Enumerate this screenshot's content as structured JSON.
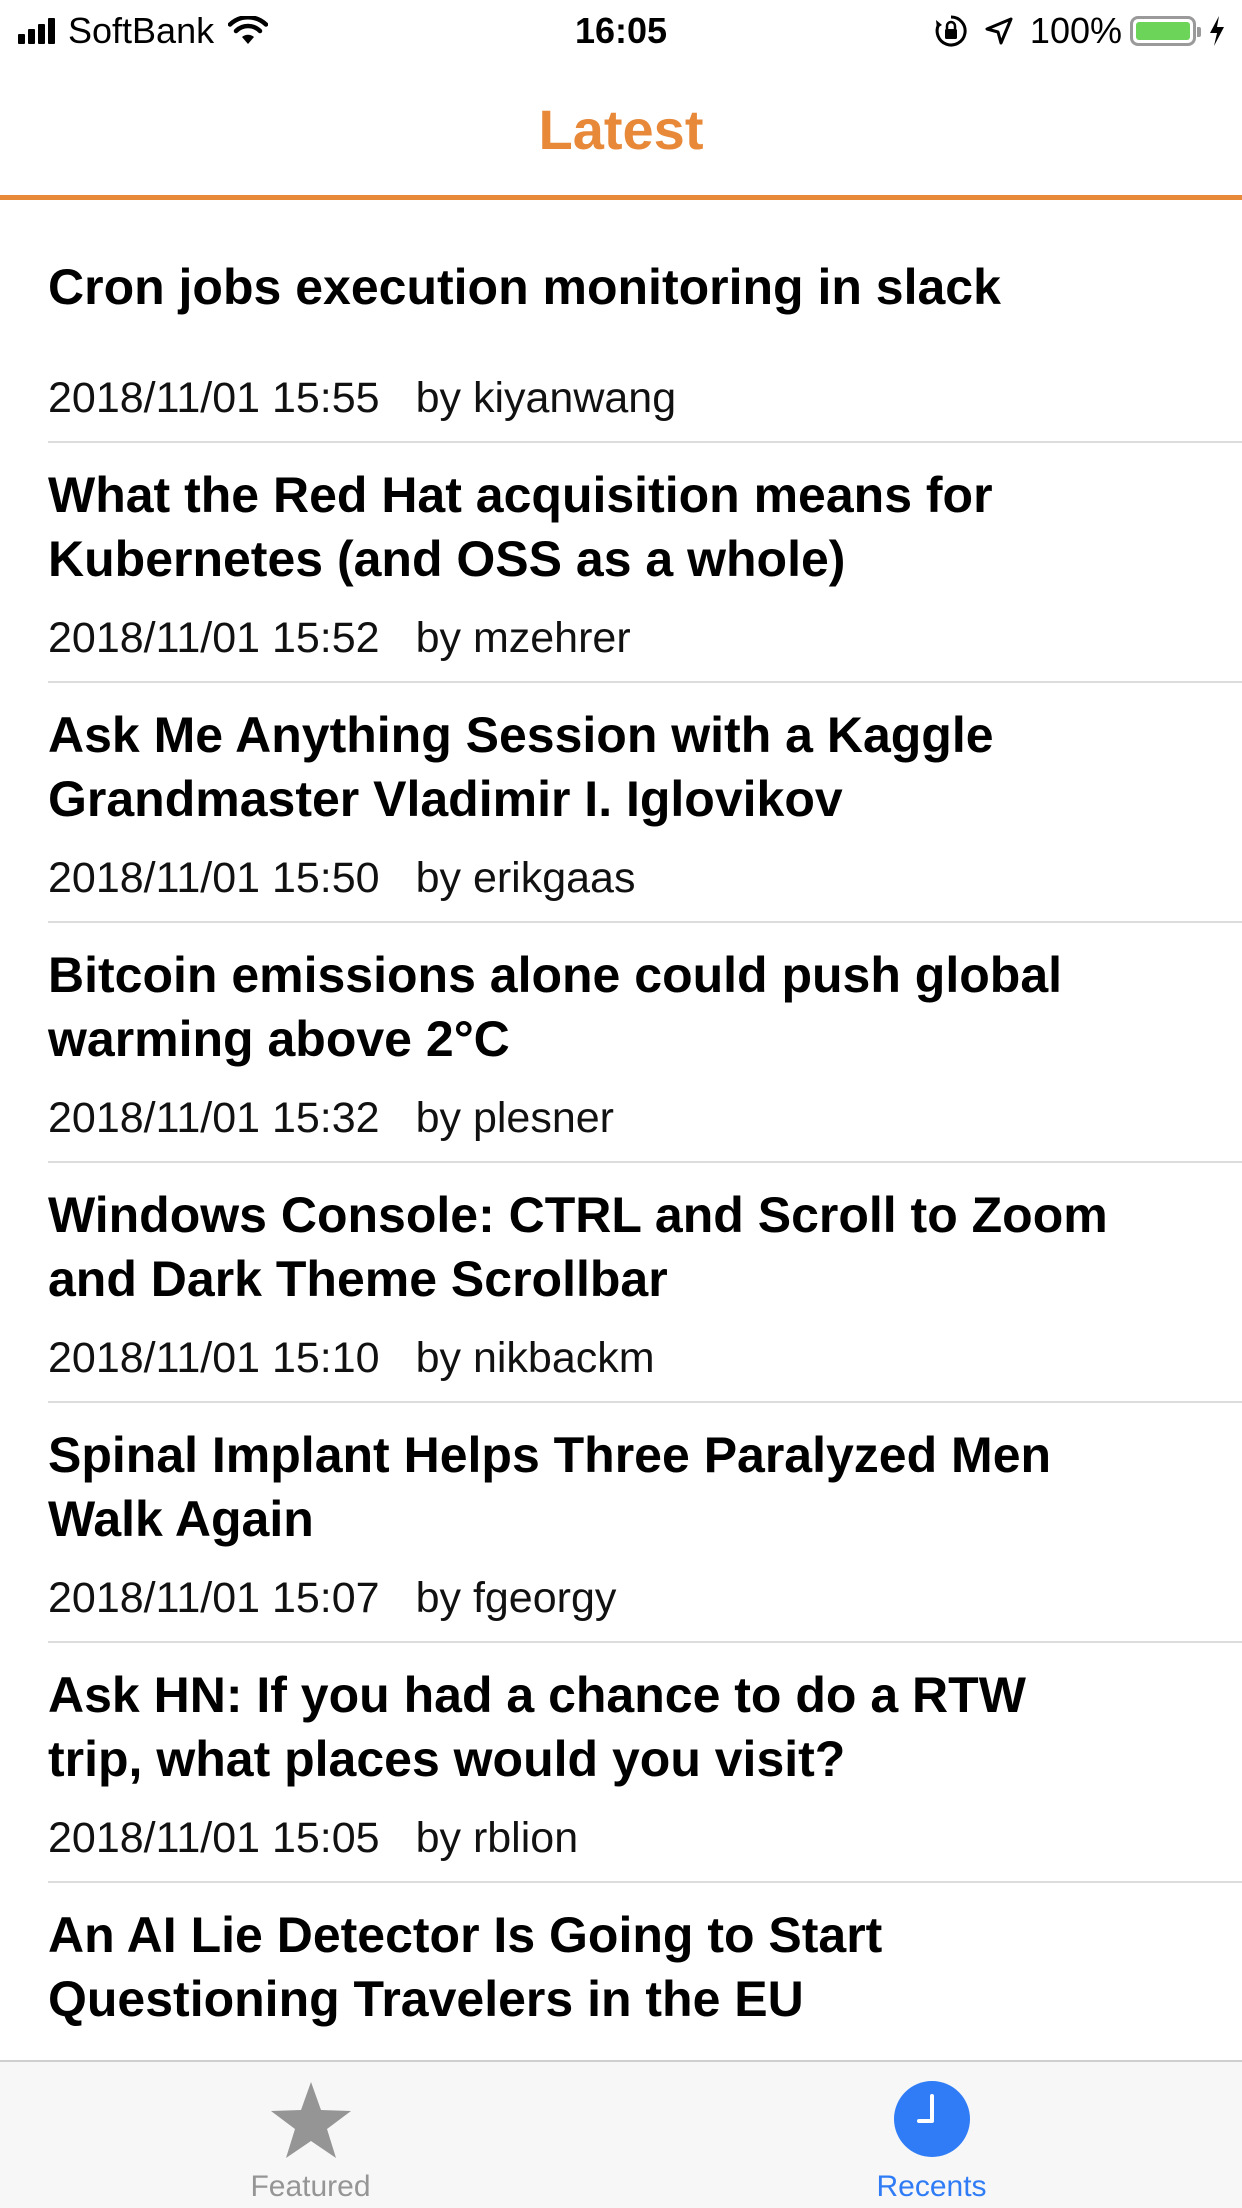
{
  "status_bar": {
    "carrier": "SoftBank",
    "time": "16:05",
    "battery_percent": "100%",
    "battery_level": 1.0,
    "icons": [
      "signal-bars-icon",
      "wifi-icon",
      "rotation-lock-icon",
      "location-arrow-icon",
      "battery-icon",
      "charging-bolt-icon"
    ]
  },
  "nav": {
    "title": "Latest"
  },
  "colors": {
    "accent": "#e8893a",
    "tab_active": "#2f7cf6",
    "tab_inactive": "#959595",
    "separator": "#dcdcdc"
  },
  "items": [
    {
      "title": "Cron jobs execution monitoring in slack",
      "date": "2018/11/01 15:55",
      "author": "by kiyanwang"
    },
    {
      "title": "What the Red Hat acquisition means for Kubernetes (and OSS as a whole)",
      "date": "2018/11/01 15:52",
      "author": "by mzehrer"
    },
    {
      "title": "Ask Me Anything Session with a Kaggle Grandmaster Vladimir I. Iglovikov",
      "date": "2018/11/01 15:50",
      "author": "by erikgaas"
    },
    {
      "title": "Bitcoin emissions alone could push global warming above 2°C",
      "date": "2018/11/01 15:32",
      "author": "by plesner"
    },
    {
      "title": "Windows Console: CTRL and Scroll to Zoom and Dark Theme Scrollbar",
      "date": "2018/11/01 15:10",
      "author": "by nikbackm"
    },
    {
      "title": "Spinal Implant Helps Three Paralyzed Men Walk Again",
      "date": "2018/11/01 15:07",
      "author": "by fgeorgy"
    },
    {
      "title": "Ask HN: If you had a chance to do a RTW trip, what places would you visit?",
      "date": "2018/11/01 15:05",
      "author": "by rblion"
    },
    {
      "title": "An AI Lie Detector Is Going to Start Questioning Travelers in the EU",
      "date": "",
      "author": ""
    }
  ],
  "tab_bar": {
    "tabs": [
      {
        "label": "Featured",
        "icon": "star-icon",
        "active": false
      },
      {
        "label": "Recents",
        "icon": "clock-icon",
        "active": true
      }
    ]
  }
}
